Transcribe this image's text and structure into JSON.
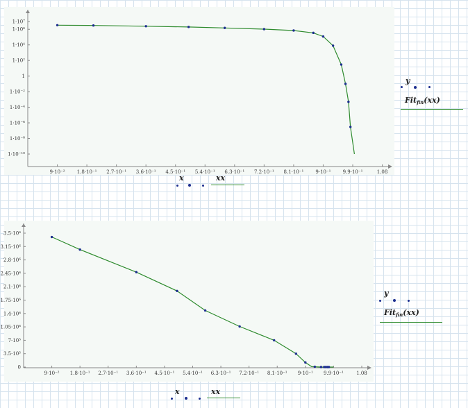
{
  "colors": {
    "data_points": "#1c2e8f",
    "fit_line": "#2e8b2e",
    "axis": "#888888"
  },
  "chart_data": [
    {
      "type": "scatter",
      "yscale": "log",
      "xlim": [
        0.0,
        1.1
      ],
      "ylim": [
        1e-11,
        50000000.0
      ],
      "x_ticks": [
        "9·10⁻²",
        "1.8·10⁻¹",
        "2.7·10⁻¹",
        "3.6·10⁻¹",
        "4.5·10⁻¹",
        "5.4·10⁻¹",
        "6.3·10⁻¹",
        "7.2·10⁻¹",
        "8.1·10⁻¹",
        "9·10⁻¹",
        "9.9·10⁻¹",
        "1.08"
      ],
      "x_tick_values": [
        0.09,
        0.18,
        0.27,
        0.36,
        0.45,
        0.54,
        0.63,
        0.72,
        0.81,
        0.9,
        0.99,
        1.08
      ],
      "y_ticks": [
        "1·10⁷",
        "1·10⁶",
        "1·10⁴",
        "1·10²",
        "1",
        "1·10⁻²",
        "1·10⁻⁴",
        "1·10⁻⁶",
        "1·10⁻⁸",
        "1·10⁻¹⁰"
      ],
      "y_tick_values": [
        10000000.0,
        1000000.0,
        10000.0,
        100.0,
        1,
        0.01,
        0.0001,
        1e-06,
        1e-08,
        1e-10
      ],
      "x_label": "x",
      "x_label_fit": "xx",
      "legend": [
        "y",
        "Fit_fin(xx)"
      ],
      "series": [
        {
          "name": "y",
          "kind": "points",
          "x": [
            0.09,
            0.2,
            0.36,
            0.49,
            0.6,
            0.72,
            0.81,
            0.87,
            0.9,
            0.93,
            0.955,
            0.968,
            0.977,
            0.983
          ],
          "y": [
            3400000.0,
            3100000.0,
            2500000.0,
            2000000.0,
            1500000.0,
            1050000.0,
            700000.0,
            350000.0,
            120000.0,
            8000.0,
            30,
            0.1,
            0.0005,
            3e-07
          ]
        },
        {
          "name": "Fit_fin(xx)",
          "kind": "line",
          "x": [
            0.09,
            0.2,
            0.36,
            0.49,
            0.6,
            0.72,
            0.81,
            0.87,
            0.9,
            0.93,
            0.955,
            0.968,
            0.977,
            0.983,
            0.995
          ],
          "y": [
            3400000.0,
            3100000.0,
            2500000.0,
            2000000.0,
            1500000.0,
            1050000.0,
            700000.0,
            350000.0,
            120000.0,
            8000.0,
            30,
            0.1,
            0.0005,
            3e-07,
            1e-10
          ]
        }
      ]
    },
    {
      "type": "scatter",
      "yscale": "linear",
      "xlim": [
        0.0,
        1.1
      ],
      "ylim": [
        -100000,
        3700000
      ],
      "x_ticks": [
        "9·10⁻²",
        "1.8·10⁻¹",
        "2.7·10⁻¹",
        "3.6·10⁻¹",
        "4.5·10⁻¹",
        "5.4·10⁻¹",
        "6.3·10⁻¹",
        "7.2·10⁻¹",
        "8.1·10⁻¹",
        "9·10⁻¹",
        "9.9·10⁻¹",
        "1.08"
      ],
      "x_tick_values": [
        0.09,
        0.18,
        0.27,
        0.36,
        0.45,
        0.54,
        0.63,
        0.72,
        0.81,
        0.9,
        0.99,
        1.08
      ],
      "y_ticks": [
        "3.5·10⁶",
        "3.15·10⁶",
        "2.8·10⁶",
        "2.45·10⁶",
        "2.1·10⁶",
        "1.75·10⁶",
        "1.4·10⁶",
        "1.05·10⁶",
        "7·10⁵",
        "3.5·10⁵",
        "0"
      ],
      "y_tick_values": [
        3500000,
        3150000,
        2800000,
        2450000,
        2100000,
        1750000,
        1400000,
        1050000,
        700000,
        350000,
        0
      ],
      "x_label": "x",
      "x_label_fit": "xx",
      "legend": [
        "y",
        "Fit_fin(xx)"
      ],
      "series": [
        {
          "name": "y",
          "kind": "points",
          "x": [
            0.09,
            0.18,
            0.36,
            0.49,
            0.58,
            0.69,
            0.8,
            0.87,
            0.9,
            0.93,
            0.95,
            0.96,
            0.965,
            0.97,
            0.975
          ],
          "y": [
            3400000,
            3070000,
            2480000,
            1990000,
            1480000,
            1060000,
            700000,
            350000,
            120000,
            8000,
            30,
            0.1,
            0.0005,
            3e-07,
            0
          ]
        },
        {
          "name": "Fit_fin(xx)",
          "kind": "line",
          "x": [
            0.09,
            0.18,
            0.36,
            0.49,
            0.58,
            0.69,
            0.8,
            0.87,
            0.9,
            0.92,
            0.95,
            0.99
          ],
          "y": [
            3400000,
            3070000,
            2480000,
            1990000,
            1480000,
            1060000,
            700000,
            350000,
            120000,
            10000,
            0,
            0
          ]
        }
      ]
    }
  ]
}
